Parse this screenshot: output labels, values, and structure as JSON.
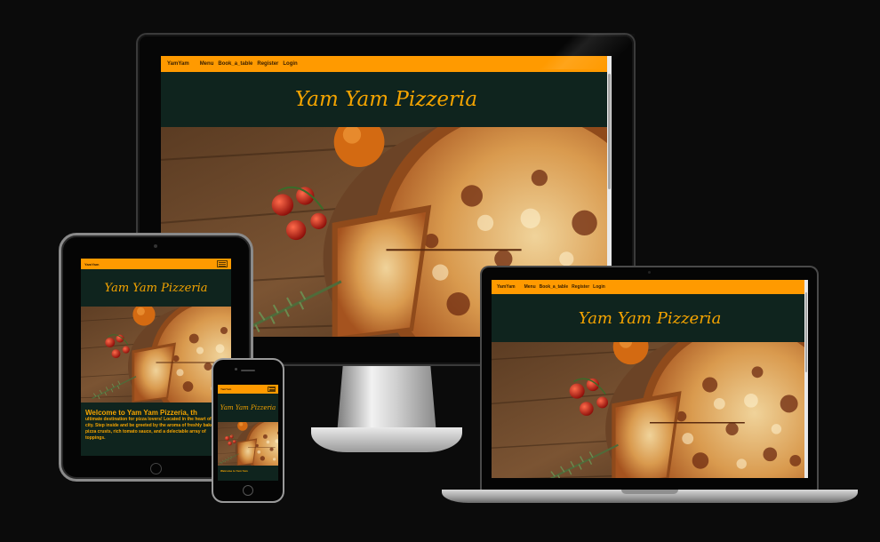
{
  "site": {
    "brand": "YamYam",
    "nav_links": [
      "Menu",
      "Book_a_table",
      "Register",
      "Login"
    ],
    "title": "Yam Yam Pizzeria",
    "welcome_tablet": "Welcome to Yam Yam Pizzeria, th",
    "welcome_tablet_body": "ultimate destination for pizza lovers! Located in the heart of the city. Step inside and be greeted by the aroma of freshly baked pizza crusts, rich tomato sauce, and a delectable array of toppings.",
    "welcome_phone": "Welcome to Yam Yam"
  },
  "colors": {
    "nav_background": "#ff9a00",
    "header_background": "#0f241e",
    "title_color": "#f5a400",
    "page_background": "#0b0b0b"
  },
  "icons": {
    "menu_toggle": "hamburger-icon"
  }
}
